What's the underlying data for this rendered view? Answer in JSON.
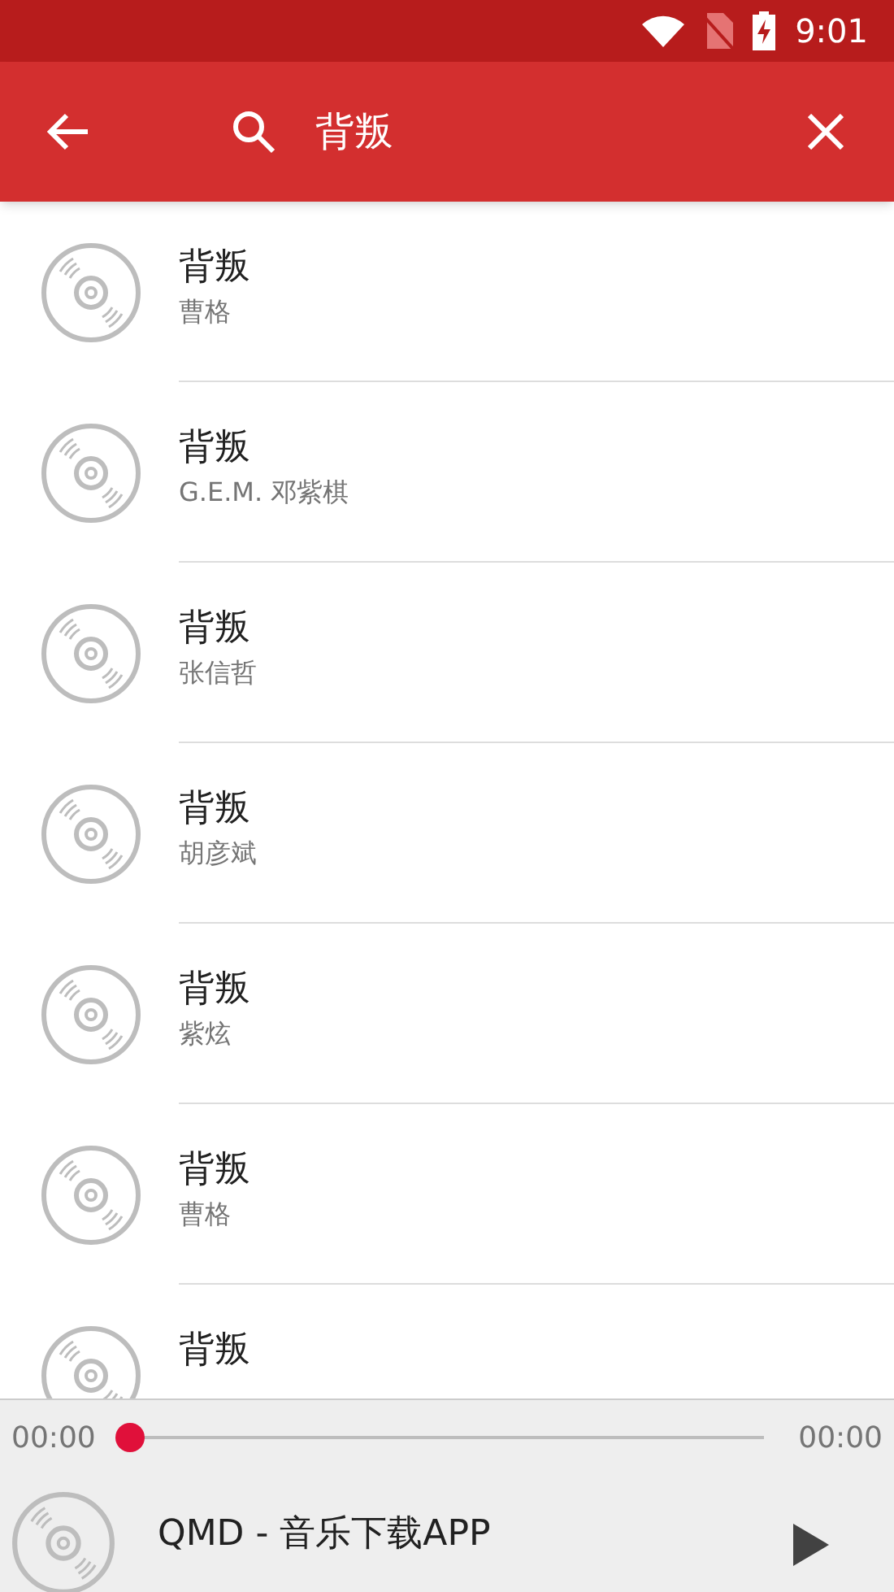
{
  "status_bar": {
    "time": "9:01"
  },
  "toolbar": {
    "search_value": "背叛"
  },
  "results": [
    {
      "title": "背叛",
      "artist": "曹格"
    },
    {
      "title": "背叛",
      "artist": "G.E.M. 邓紫棋"
    },
    {
      "title": "背叛",
      "artist": "张信哲"
    },
    {
      "title": "背叛",
      "artist": "胡彦斌"
    },
    {
      "title": "背叛",
      "artist": "紫炫"
    },
    {
      "title": "背叛",
      "artist": "曹格"
    },
    {
      "title": "背叛"
    }
  ],
  "player": {
    "elapsed": "00:00",
    "duration": "00:00",
    "level": 0,
    "title": "QMD - 音乐下载APP",
    "playing": false
  }
}
